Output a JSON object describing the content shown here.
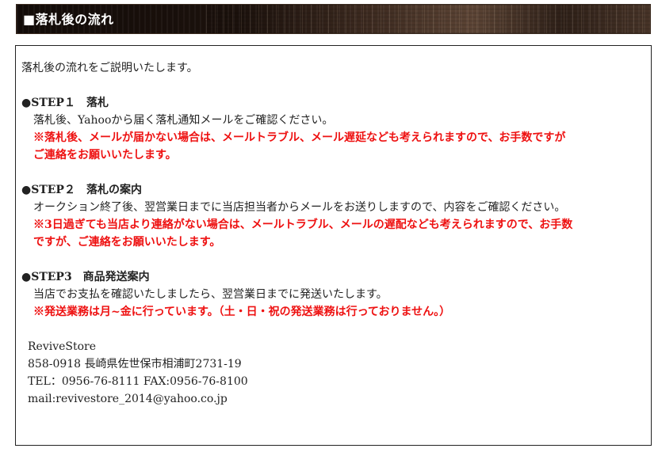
{
  "header": {
    "title": "■落札後の流れ"
  },
  "intro": "落札後の流れをご説明いたします。",
  "steps": [
    {
      "title": "●STEP１　落札",
      "lines": [
        "落札後、Yahooから届く落札通知メールをご確認ください。"
      ],
      "notes": [
        "※落札後、メールが届かない場合は、メールトラブル、メール遅延なども考えられますので、お手数ですが",
        "ご連絡をお願いいたします。"
      ]
    },
    {
      "title": "●STEP２　落札の案内",
      "lines": [
        "オークション終了後、翌営業日までに当店担当者からメールをお送りしますので、内容をご確認ください。"
      ],
      "notes": [
        "※3日過ぎても当店より連絡がない場合は、メールトラブル、メールの遅配なども考えられますので、お手数",
        "ですが、ご連絡をお願いいたします。"
      ]
    },
    {
      "title": "●STEP3　商品発送案内",
      "lines": [
        "当店でお支払を確認いたしましたら、翌営業日までに発送いたします。"
      ],
      "notes": [
        "※発送業務は月~金に行っています。（土・日・祝の発送業務は行っておりません。）"
      ]
    }
  ],
  "store": {
    "name": "ReviveStore",
    "address": "858-0918 長崎県佐世保市相浦町2731-19",
    "phone": "TEL：0956-76-8111 FAX:0956-76-8100",
    "email": "mail:revivestore_2014@yahoo.co.jp"
  },
  "colors": {
    "accent_red": "#ee1111",
    "text": "#222222",
    "header_text": "#ffffff"
  }
}
